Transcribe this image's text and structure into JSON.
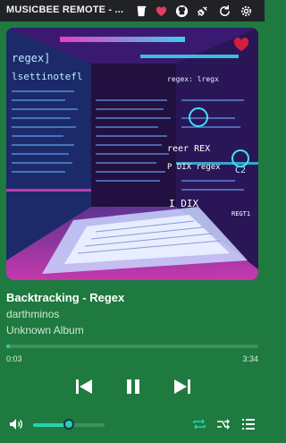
{
  "window": {
    "title": "MUSICBEE REMOTE - ..."
  },
  "titlebar_icons": [
    "cup-icon",
    "heart-icon",
    "github-icon",
    "plug-icon",
    "refresh-icon",
    "gear-icon"
  ],
  "track": {
    "title": "Backtracking - Regex",
    "artist": "darthminos",
    "album": "Unknown Album",
    "favorite": true
  },
  "playback": {
    "current_time": "0:03",
    "total_time": "3:34",
    "progress_fraction": 0.014,
    "state": "playing"
  },
  "volume": {
    "level_fraction": 0.5
  },
  "artwork_text": {
    "top_lines": [
      "regex]",
      "lsettinotefl",
      "regex: lregx"
    ],
    "wall_lines": [
      "reer REX",
      "P DIX regex",
      "I DIX"
    ],
    "codes": [
      "C2",
      "REGT1"
    ]
  },
  "colors": {
    "background": "#1e7a3f",
    "titlebar": "#202225",
    "accent": "#2ad0b0",
    "heart": "#e0405c"
  }
}
